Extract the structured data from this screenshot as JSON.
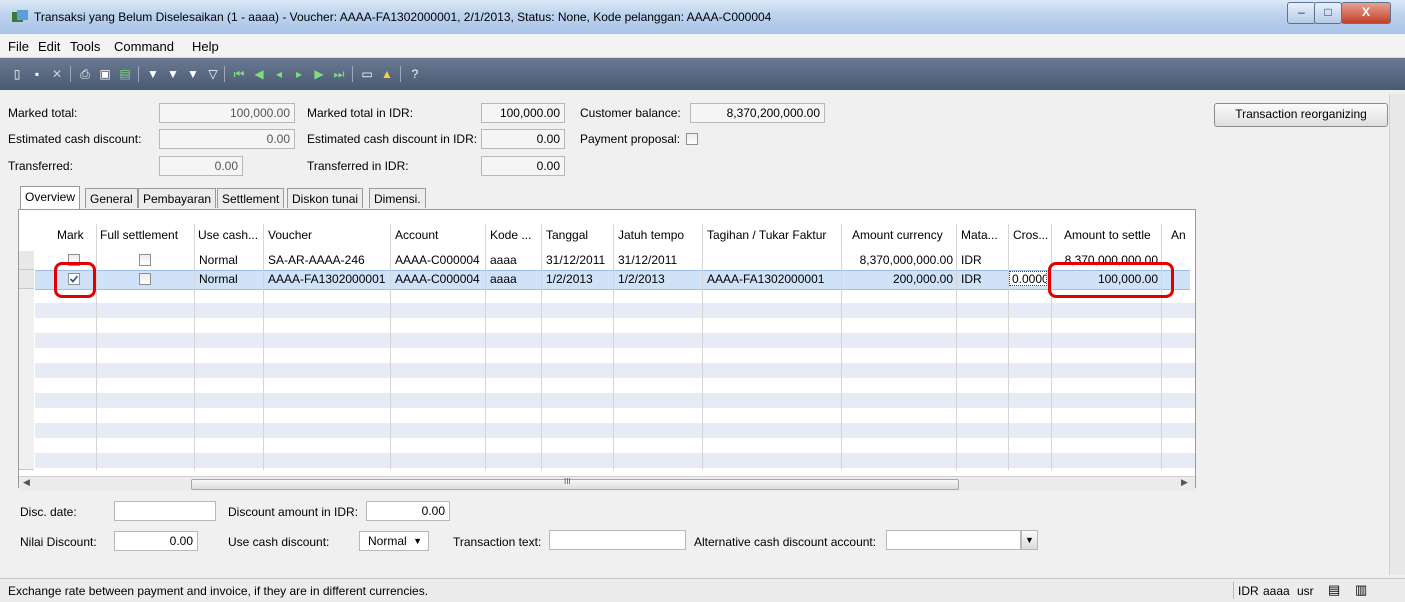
{
  "window": {
    "title": "Transaksi yang Belum Diselesaikan (1 - aaaa) - Voucher: AAAA-FA1302000001, 2/1/2013, Status: None, Kode pelanggan: AAAA-C000004",
    "minimize_glyph": "–",
    "maximize_glyph": "□",
    "close_glyph": "X"
  },
  "menu": [
    "File",
    "Edit",
    "Tools",
    "Command",
    "Help"
  ],
  "form": {
    "marked_total_label": "Marked total:",
    "marked_total_value": "100,000.00",
    "marked_total_idr_label": "Marked total in IDR:",
    "marked_total_idr_value": "100,000.00",
    "customer_balance_label": "Customer balance:",
    "customer_balance_value": "8,370,200,000.00",
    "est_cash_discount_label": "Estimated cash discount:",
    "est_cash_discount_value": "0.00",
    "est_cash_discount_idr_label": "Estimated cash discount in IDR:",
    "est_cash_discount_idr_value": "0.00",
    "payment_proposal_label": "Payment proposal:",
    "transferred_label": "Transferred:",
    "transferred_value": "0.00",
    "transferred_idr_label": "Transferred in IDR:",
    "transferred_idr_value": "0.00",
    "reorganize_button": "Transaction reorganizing"
  },
  "tabs": [
    "Overview",
    "General",
    "Pembayaran",
    "Settlement",
    "Diskon tunai",
    "Dimensi."
  ],
  "grid": {
    "headers": [
      "Mark",
      "Full settlement",
      "Use cash...",
      "Voucher",
      "Account",
      "Kode ...",
      "Tanggal",
      "Jatuh tempo",
      "Tagihan / Tukar Faktur",
      "Amount currency",
      "Mata...",
      "Cros...",
      "Amount to settle",
      "An"
    ],
    "rows": [
      {
        "mark": false,
        "full": false,
        "use_cash": "Normal",
        "voucher": "SA-AR-AAAA-246",
        "account": "AAAA-C000004",
        "kode": "aaaa",
        "tanggal": "31/12/2011",
        "jatuh": "31/12/2011",
        "tagihan": "",
        "amount_currency": "8,370,000,000.00",
        "mata": "IDR",
        "cros": "",
        "amount_settle": "8,370,000,000.00"
      },
      {
        "mark": true,
        "full": false,
        "use_cash": "Normal",
        "voucher": "AAAA-FA1302000001",
        "account": "AAAA-C000004",
        "kode": "aaaa",
        "tanggal": "1/2/2013",
        "jatuh": "1/2/2013",
        "tagihan": "AAAA-FA1302000001",
        "amount_currency": "200,000.00",
        "mata": "IDR",
        "cros": "0.0000",
        "amount_settle": "100,000.00"
      }
    ],
    "scroll_marker": "III"
  },
  "bottom": {
    "disc_date_label": "Disc. date:",
    "discount_idr_label": "Discount amount in IDR:",
    "discount_idr_value": "0.00",
    "nilai_discount_label": "Nilai Discount:",
    "nilai_discount_value": "0.00",
    "use_cash_discount_label": "Use cash discount:",
    "use_cash_discount_value": "Normal",
    "transaction_text_label": "Transaction text:",
    "alt_account_label": "Alternative cash discount account:"
  },
  "status": {
    "message": "Exchange rate between payment and invoice, if they are in different currencies.",
    "currency": "IDR",
    "company": "aaaa",
    "user": "usr"
  },
  "colors": {
    "highlight": "#e00000",
    "toolbar": "#4a5a72",
    "selection": "#cfe2f8"
  }
}
